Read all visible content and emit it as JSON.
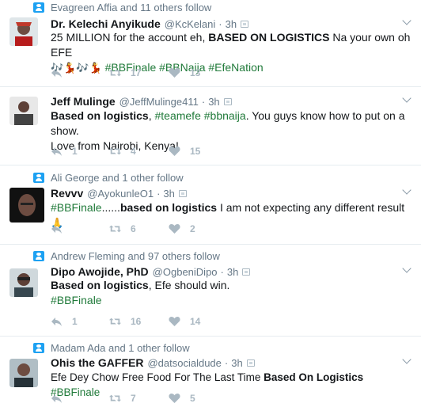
{
  "tweets": [
    {
      "social": "Evagreen Affia and 11 others follow",
      "name": "Dr. Kelechi Anyikude",
      "handle": "@KcKelani",
      "time": "3h",
      "text_line1_pre": "25 MILLION for the account eh, ",
      "text_line1_bold": "BASED ON LOGISTICS",
      "text_line1_post": " Na your own oh EFE",
      "emojis": "🎶💃🎶💃",
      "hashtags": "#BBFinale #BBNaija #EfeNation",
      "retweets": "17",
      "likes": "13",
      "avatar_color": "#c0392b"
    },
    {
      "name": "Jeff Mulinge",
      "handle": "@JeffMulinge411",
      "time": "3h",
      "text_bold": "Based on logistics",
      "text_sep": ", ",
      "hashtag1": "#teamefe",
      "hashtag2": "#bbnaija",
      "text_post": ". You guys know how to put on a show.",
      "text_line2": "Love from Nairobi, Kenya!",
      "replies": "1",
      "retweets": "4",
      "likes": "15"
    },
    {
      "social": "Ali George and 1 other follow",
      "name": "Revvv",
      "handle": "@AyokunleO1",
      "time": "3h",
      "hashtag": "#BBFinale",
      "dots": "......",
      "text_bold": "based on logistics",
      "text_post": " I am not expecting any different result",
      "emoji": "🙏",
      "retweets": "6",
      "likes": "2"
    },
    {
      "social": "Andrew Fleming and 97 others follow",
      "name": "Dipo Awojide, PhD",
      "handle": "@OgbeniDipo",
      "time": "3h",
      "text_bold": "Based on logistics",
      "text_post": ", Efe should win.",
      "hashtag": "#BBFinale",
      "replies": "1",
      "retweets": "16",
      "likes": "14"
    },
    {
      "social": "Madam Ada and 1 other follow",
      "name": "Ohis the GAFFER",
      "handle": "@datsocialdude",
      "time": "3h",
      "text_pre": "Efe Dey Chow Free Food For The Last Time ",
      "text_bold": "Based On Logistics",
      "hashtag": "#BBFinale",
      "retweets": "7",
      "likes": "5"
    }
  ],
  "dot": "·",
  "colors": {
    "hashtag": "#207a3a",
    "meta": "#657786",
    "action": "#aab8c2",
    "follow_icon": "#1da1f2"
  }
}
